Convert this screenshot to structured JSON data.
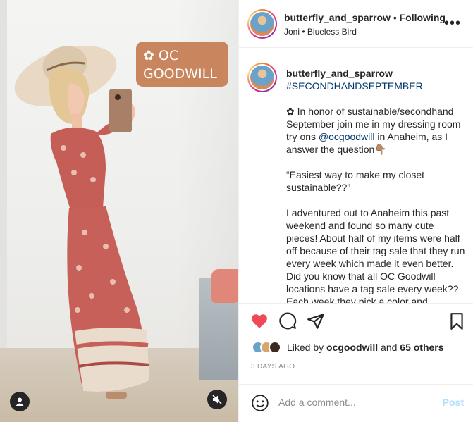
{
  "media": {
    "sticker": {
      "icon": "flower-icon",
      "line1": "OC",
      "line2": "GOODWILL",
      "color": "#c8855e"
    }
  },
  "header": {
    "username": "butterfly_and_sparrow",
    "separator": "•",
    "follow_label": "Following",
    "audio_artist": "Joni",
    "audio_dot": "•",
    "audio_song": "Blueless Bird"
  },
  "caption": {
    "username": "butterfly_and_sparrow",
    "hashtag": "#SECONDHANDSEPTEMBER",
    "p1_icon": "✿",
    "p1_a": " In honor of sustainable/secondhand September join me in my dressing room try ons ",
    "p1_mention": "@ocgoodwill",
    "p1_b": " in Anaheim, as I answer the question",
    "p1_emoji": "👇🏽",
    "p2": "“Easiest way to make my closet sustainable??”",
    "p3": "I adventured out to Anaheim this past weekend and found so many cute pieces! About half of my items were half off because of their tag sale that they run every week which made it even better. Did you know that all OC Goodwill locations have a tag sale every week?? Each week they pick a color and"
  },
  "actions": {
    "like_icon": "heart-filled-icon",
    "comment_icon": "comment-bubble-icon",
    "share_icon": "paper-plane-icon",
    "save_icon": "bookmark-icon",
    "like_color": "#ed4956"
  },
  "likes": {
    "prefix": "Liked by ",
    "user": "ocgoodwill",
    "middle": " and ",
    "others": "65 others"
  },
  "date": "3 DAYS AGO",
  "comment_box": {
    "placeholder": "Add a comment...",
    "post_label": "Post"
  }
}
